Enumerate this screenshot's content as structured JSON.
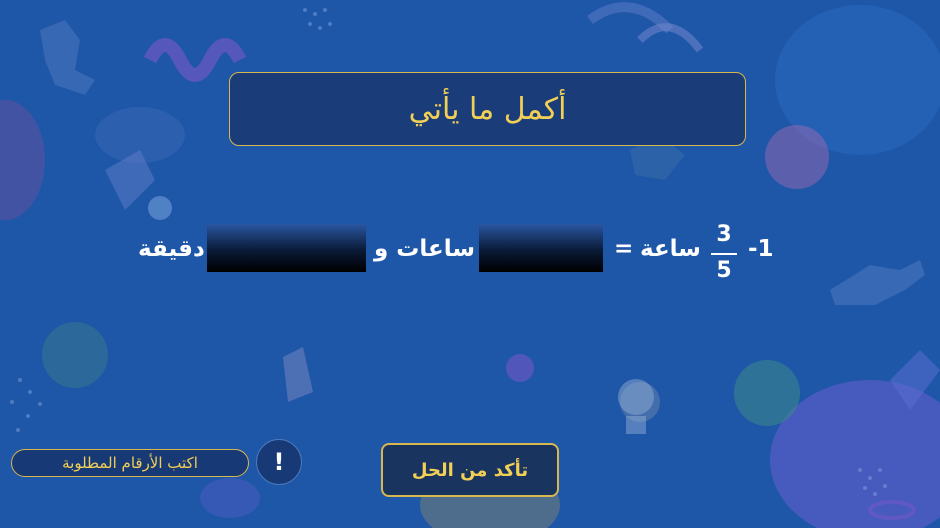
{
  "title": "أكمل ما يأتي",
  "question": {
    "number": "-1",
    "fraction": {
      "numerator": "3",
      "denominator": "5"
    },
    "unit_hour": "ساعة",
    "equals": "=",
    "hours_label": "ساعات و",
    "minutes_label": "دقيقة",
    "hours_value": "",
    "minutes_value": ""
  },
  "hint": {
    "label": "اكتب الأرقام المطلوبة"
  },
  "info_button": {
    "glyph": "!"
  },
  "check_button": {
    "label": "تأكد من الحل"
  },
  "colors": {
    "background": "#1e56a8",
    "accent_gold": "#f2cf55",
    "panel": "#1a3d7a"
  }
}
